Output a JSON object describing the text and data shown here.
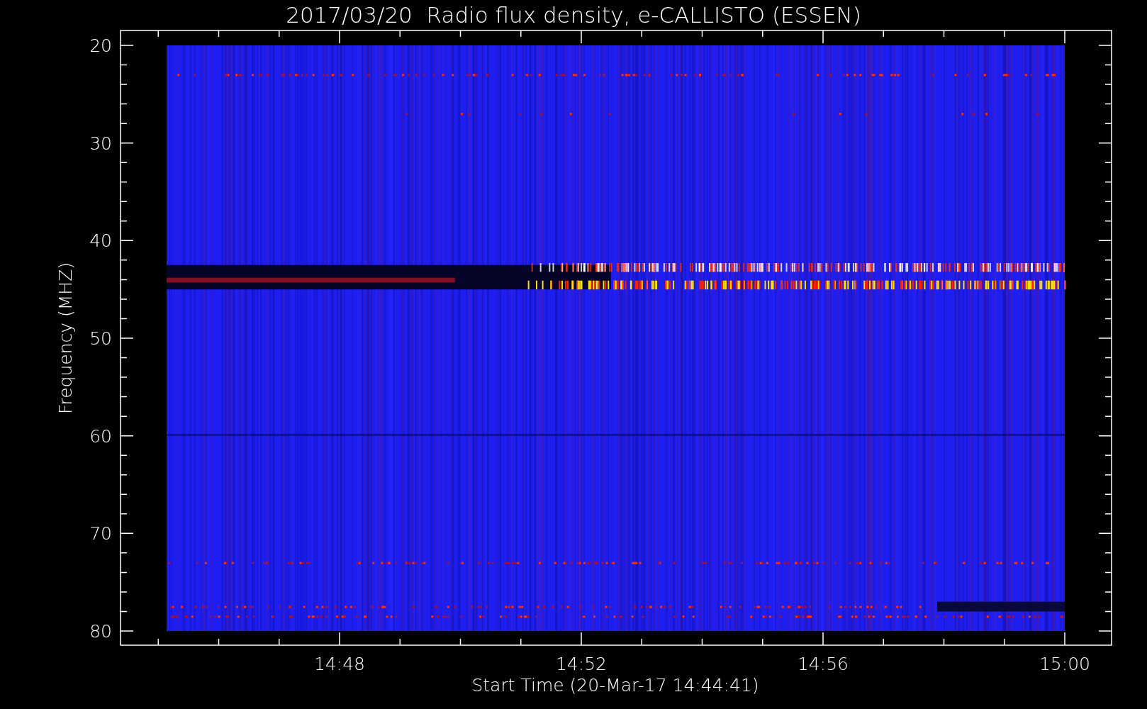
{
  "title": "2017/03/20  Radio flux density, e-CALLISTO (ESSEN)",
  "y_axis": {
    "label": "Frequency (MHZ)",
    "ticks": [
      "20",
      "30",
      "40",
      "50",
      "60",
      "70",
      "80"
    ]
  },
  "x_axis": {
    "label": "Start Time (20-Mar-17 14:44:41)",
    "ticks": [
      "14:48",
      "14:52",
      "14:56",
      "15:00"
    ]
  }
}
